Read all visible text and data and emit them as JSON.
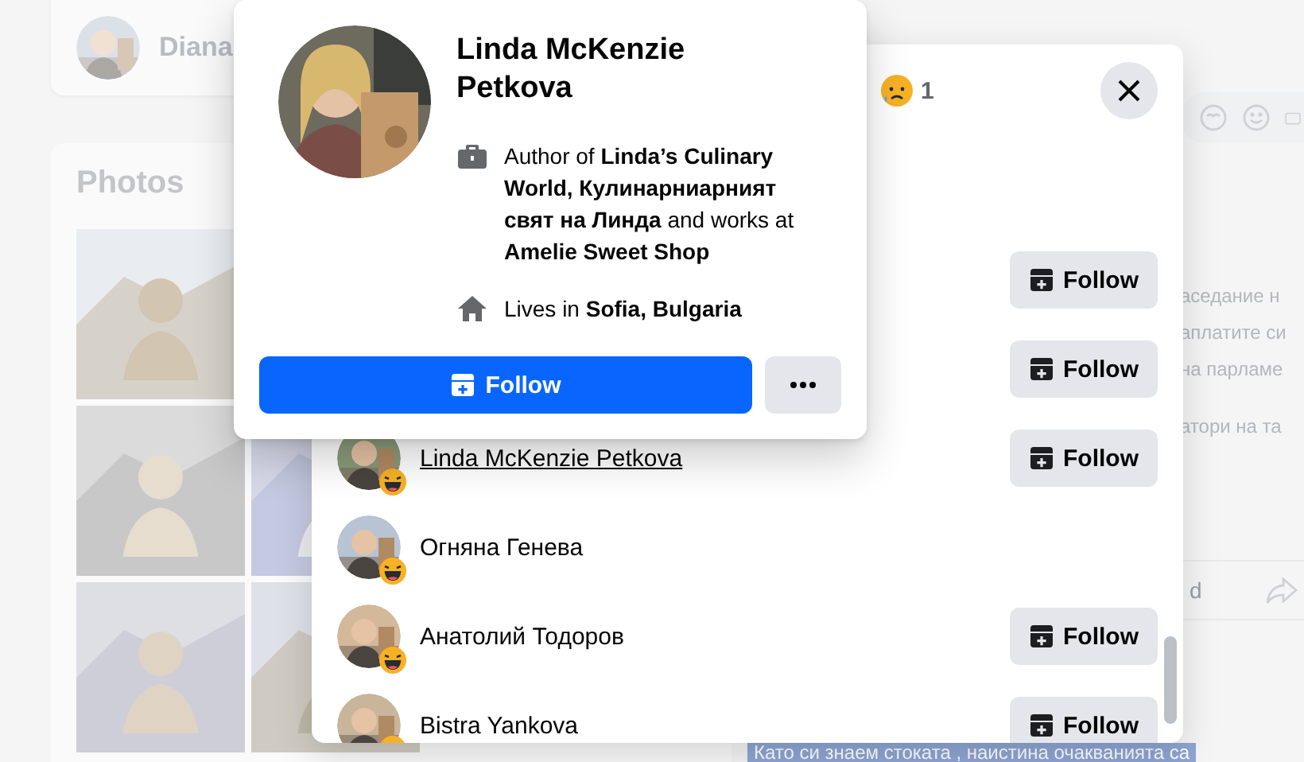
{
  "background": {
    "profile": {
      "name": "Diana"
    },
    "photos": {
      "title": "Photos"
    },
    "post": {
      "text_lines": [
        "аседание н",
        "аплатите си",
        "на парламе",
        "атори на та"
      ],
      "action_label": "d",
      "selected_text": "Като си знаем стоката , наистина очакванията са"
    }
  },
  "reactions_dialog": {
    "reaction_filter": {
      "count": "1"
    },
    "rows": [
      {
        "follow_button": "Follow"
      },
      {
        "follow_button": "Follow"
      },
      {
        "name": "Linda McKenzie Petkova",
        "hovered": true,
        "follow_button": "Follow"
      },
      {
        "name": "Огняна Генева",
        "hovered": false
      },
      {
        "name": "Анатолий Тодоров",
        "hovered": false,
        "follow_button": "Follow"
      },
      {
        "name": "Bistra Yankova",
        "hovered": false,
        "follow_button": "Follow"
      }
    ]
  },
  "hover_card": {
    "name": "Linda McKenzie Petkova",
    "work": "Author of **Linda’s Culinary World, Кулинарниарният свят на Линда** and works at **Amelie Sweet Shop**",
    "lives": "Lives in **Sofia, Bulgaria**",
    "follow_button": "Follow"
  }
}
